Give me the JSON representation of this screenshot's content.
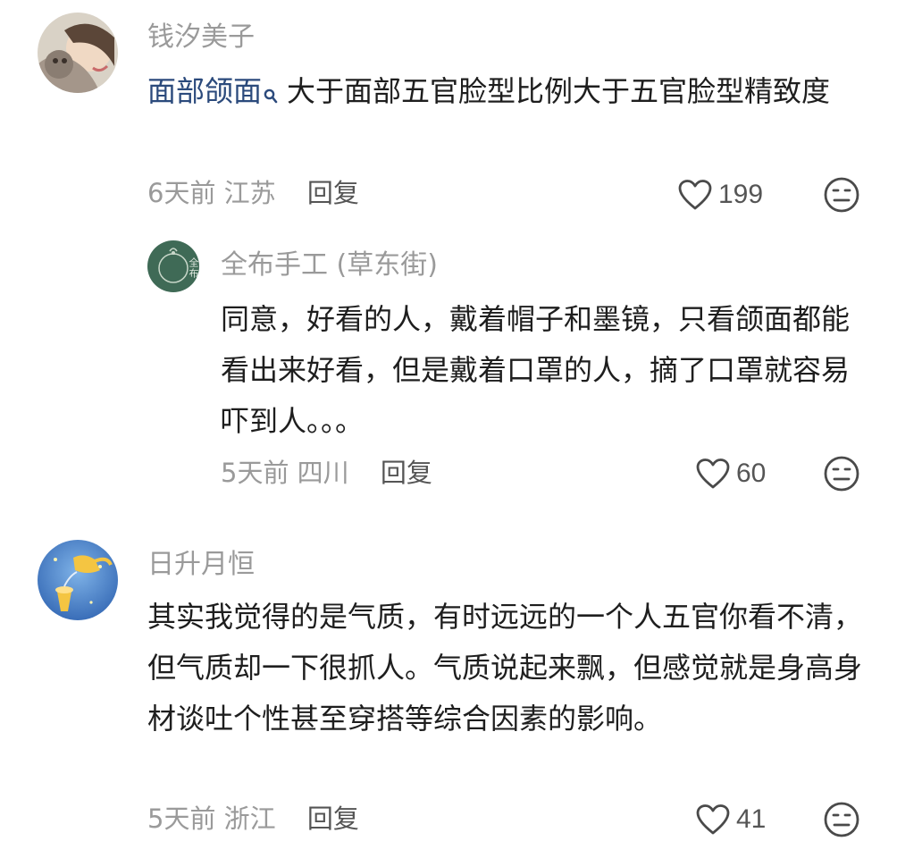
{
  "comments": [
    {
      "author": "钱汐美子",
      "link_text": "面部颌面",
      "text": "大于面部五官脸型比例大于五官脸型精致度",
      "time": "6天前",
      "location": "江苏",
      "reply_label": "回复",
      "likes": "199",
      "replies": [
        {
          "author": "全布手工 (草东街)",
          "avatar_text": "全布",
          "text": "同意，好看的人，戴着帽子和墨镜，只看颌面都能看出来好看，但是戴着口罩的人，摘了口罩就容易吓到人。。。",
          "time": "5天前",
          "location": "四川",
          "reply_label": "回复",
          "likes": "60"
        }
      ]
    },
    {
      "author": "日升月恒",
      "text": "其实我觉得的是气质，有时远远的一个人五官你看不清，但气质却一下很抓人。气质说起来飘，但感觉就是身高身材谈吐个性甚至穿搭等综合因素的影响。",
      "time": "5天前",
      "location": "浙江",
      "reply_label": "回复",
      "likes": "41"
    }
  ],
  "icons": {
    "link_marker": "search-icon",
    "like": "heart-outline-icon",
    "dislike": "unhappy-face-icon"
  },
  "colors": {
    "author": "#9a9a9a",
    "link": "#2b4a7c",
    "text": "#1e1e1e",
    "reply": "#555555",
    "reply_avatar_bg": "#3f6a56"
  }
}
